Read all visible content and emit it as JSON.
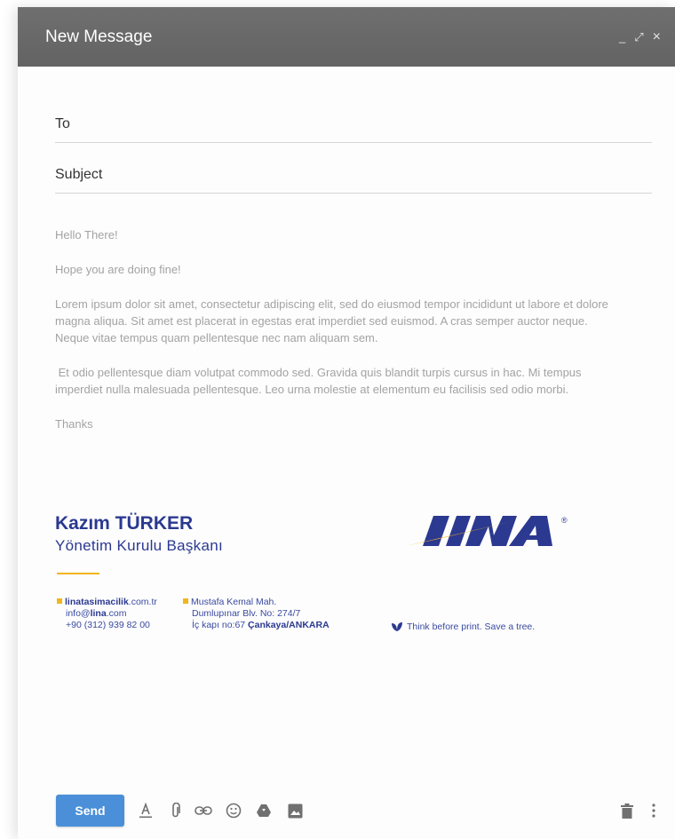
{
  "window": {
    "title": "New Message",
    "controls": {
      "minimize": "_",
      "expand": "⤢",
      "close": "×"
    }
  },
  "fields": {
    "to_label": "To",
    "to_value": "",
    "subject_label": "Subject",
    "subject_value": ""
  },
  "message": {
    "greeting": "Hello There!",
    "line2": "Hope you are doing fine!",
    "para1": "Lorem ipsum dolor sit amet, consectetur adipiscing elit, sed do eiusmod tempor incididunt ut labore et dolore magna aliqua. Sit amet est placerat in egestas erat imperdiet sed euismod. A cras semper auctor neque. Neque vitae tempus quam pellentesque nec nam aliquam sem.",
    "para2": " Et odio pellentesque diam volutpat commodo sed. Gravida quis blandit turpis cursus in hac. Mi tempus imperdiet nulla malesuada pellentesque. Leo urna molestie at elementum eu facilisis sed odio morbi.",
    "closing": "Thanks"
  },
  "signature": {
    "name": "Kazım TÜRKER",
    "role": "Yönetim Kurulu Başkanı",
    "logo_text": "LINA",
    "logo_mark": "®",
    "web_bold": "linatasimacilik",
    "web_rest": ".com.tr",
    "email_pre": "info@",
    "email_bold": "lina",
    "email_post": ".com",
    "phone": "+90 (312) 939 82 00",
    "address1": "Mustafa Kemal Mah.",
    "address2": "Dumlupınar Blv. No: 274/7",
    "address3_pre": "İç kapı no:67 ",
    "address3_bold": "Çankaya/ANKARA",
    "tree_note": "Think before print. Save a tree.",
    "brand_blue": "#2b3990",
    "brand_yellow": "#f2b51c"
  },
  "toolbar": {
    "send_label": "Send",
    "icons": [
      "formatting-icon",
      "attach-icon",
      "link-icon",
      "emoji-icon",
      "drive-icon",
      "photo-icon",
      "trash-icon",
      "more-icon"
    ]
  }
}
